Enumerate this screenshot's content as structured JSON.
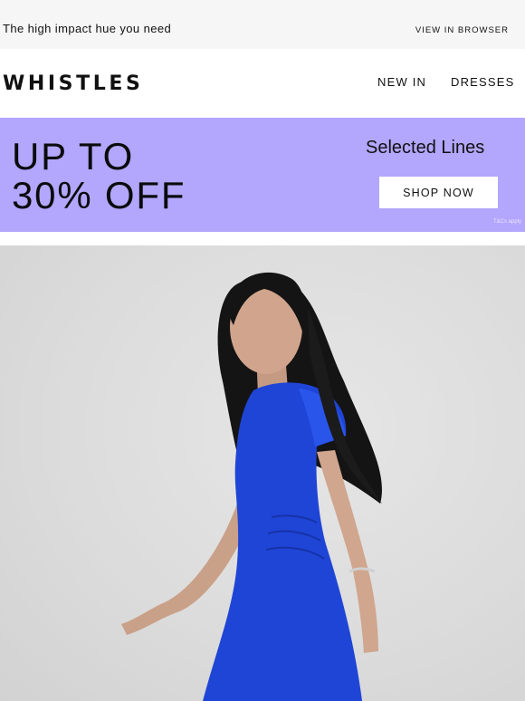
{
  "preheader": {
    "text": "The high impact hue you need",
    "view_in_browser": "VIEW IN BROWSER"
  },
  "header": {
    "logo": "WHISTLES",
    "nav": [
      "NEW IN",
      "DRESSES"
    ]
  },
  "banner": {
    "headline_line1": "UP TO",
    "headline_line2": "30% OFF",
    "subhead": "Selected Lines",
    "cta": "SHOP NOW",
    "terms": "T&Cs apply",
    "background_color": "#b3a6fd"
  },
  "hero": {
    "image_subject": "woman-in-cobalt-blue-dress",
    "dress_color": "#1f45d6",
    "background_color": "#dcdcdc"
  }
}
